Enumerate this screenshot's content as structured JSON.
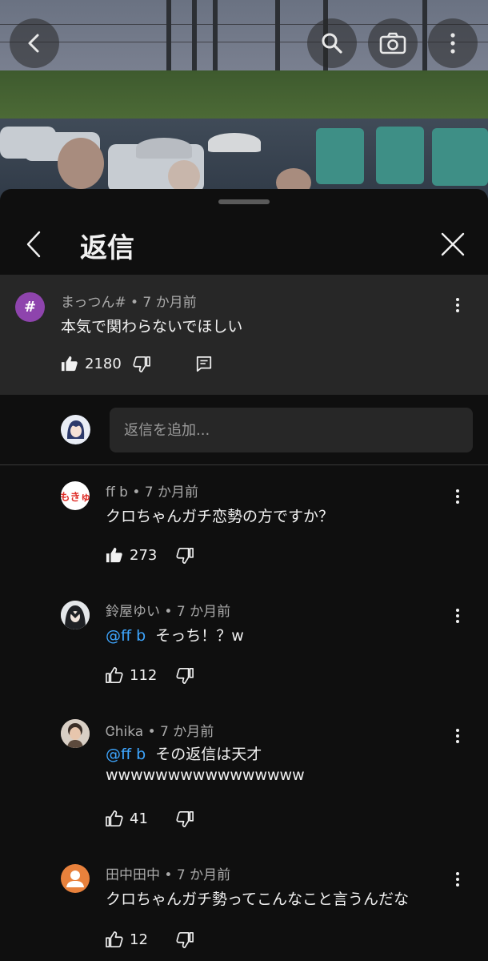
{
  "video_controls": {
    "back_icon": "chevron-left-icon",
    "search_icon": "search-icon",
    "camera_icon": "camera-icon",
    "more_icon": "more-vertical-icon"
  },
  "sheet": {
    "title": "返信",
    "back_icon": "chevron-left-icon",
    "close_icon": "close-icon"
  },
  "parent_comment": {
    "avatar_letter": "#",
    "avatar_color": "#8e44ad",
    "author": "まっつん#",
    "age": "7 か月前",
    "text": "本気で関わらないでほしい",
    "likes": "2180"
  },
  "add_reply": {
    "placeholder": "返信を追加..."
  },
  "replies": [
    {
      "author": "ff b",
      "age": "7 か月前",
      "avatar_text": "もきゅ",
      "mention": "",
      "text": "クロちゃんガチ恋勢の方ですか？",
      "text2": "",
      "likes": "273"
    },
    {
      "author": "鈴屋ゆい",
      "age": "7 か月前",
      "mention": "@ff b",
      "text": "そっち！？w",
      "text2": "",
      "likes": "112"
    },
    {
      "author": "Ꮳhika",
      "age": "7 か月前",
      "mention": "@ff b",
      "text": "その返信は天才",
      "text2": "wwwwwwwwwwwwwwww",
      "likes": "41"
    },
    {
      "author": "田中田中",
      "age": "7 か月前",
      "mention": "",
      "text": "クロちゃんガチ勢ってこんなこと言うんだな",
      "text2": "",
      "likes": "12"
    }
  ],
  "colors": {
    "background": "#0f0f0f",
    "surface": "#272727",
    "link": "#3ea6ff",
    "secondary_text": "#aaaaaa",
    "default_avatar": "#e8813c"
  }
}
